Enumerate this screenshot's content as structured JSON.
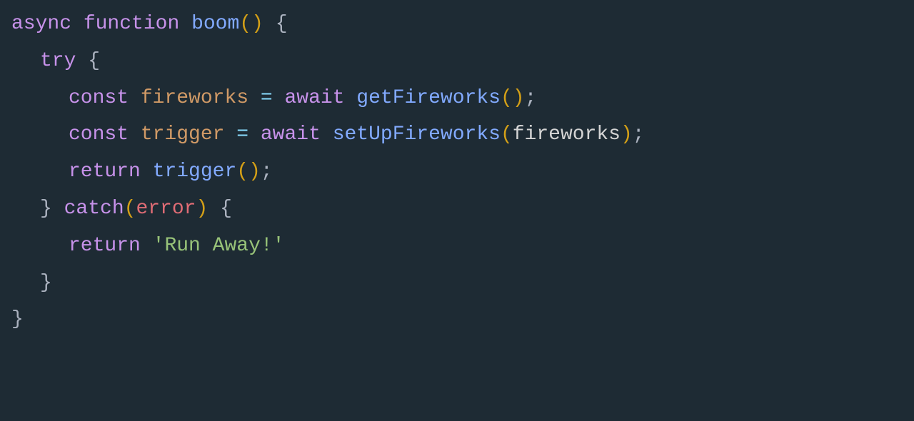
{
  "code": {
    "line1": {
      "async": "async",
      "function": "function",
      "name": "boom",
      "paren_open": "(",
      "paren_close": ")",
      "brace": " {"
    },
    "line2": {
      "try": "try",
      "brace": " {"
    },
    "line3": {
      "const": "const",
      "varname": " fireworks",
      "equals": " = ",
      "await": "await",
      "space": " ",
      "func": "getFireworks",
      "paren_open": "(",
      "paren_close": ")",
      "semi": ";"
    },
    "line4": {
      "const": "const",
      "varname": " trigger",
      "equals": " = ",
      "await": "await",
      "space": " ",
      "func": "setUpFireworks",
      "paren_open": "(",
      "arg": "fireworks",
      "paren_close": ")",
      "semi": ";"
    },
    "line5": {
      "return": "return",
      "space": " ",
      "func": "trigger",
      "paren_open": "(",
      "paren_close": ")",
      "semi": ";"
    },
    "line6": {
      "close_brace": "}",
      "space": " ",
      "catch": "catch",
      "paren_open": "(",
      "param": "error",
      "paren_close": ")",
      "brace": " {"
    },
    "line7": {
      "return": "return",
      "space": " ",
      "string": "'Run Away!'"
    },
    "line8": {
      "close_brace": "}"
    },
    "line9": {
      "close_brace": "}"
    }
  }
}
